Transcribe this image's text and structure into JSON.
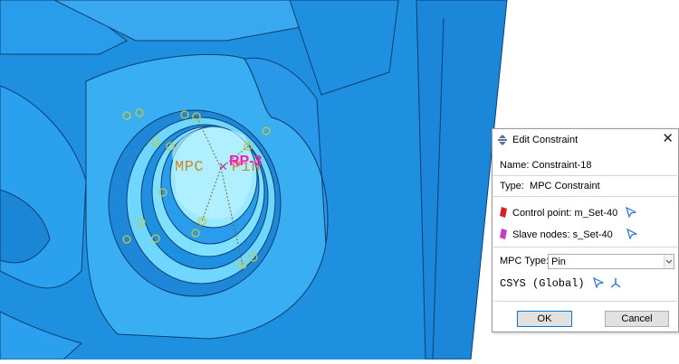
{
  "viewport": {
    "mpc_label": "MPC",
    "pin_label": "Pin",
    "rp_label": "RP-3",
    "rp_mark": "✕"
  },
  "colors": {
    "part_blue": "#1e90e6",
    "part_light": "#55c8f5",
    "label_orange": "#c98a2e",
    "rp_magenta": "#ff1ab3",
    "node_yellow": "#c8c83a"
  },
  "dialog": {
    "title": "Edit Constraint",
    "close_glyph": "✕",
    "name_label": "Name:",
    "name_value": "Constraint-18",
    "type_label": "Type:",
    "type_value": "MPC Constraint",
    "control_point_label": "Control point:",
    "control_point_value": "m_Set-40",
    "slave_nodes_label": "Slave nodes:",
    "slave_nodes_value": "s_Set-40",
    "mpc_type_label": "MPC Type:",
    "mpc_type_value": "Pin",
    "csys_label": "CSYS (Global)",
    "ok_label": "OK",
    "cancel_label": "Cancel",
    "icons": {
      "title": "edit-constraint-icon",
      "control_flag": "red-flag-icon",
      "slave_flag": "magenta-flag-icon",
      "picker": "arrow-picker-icon",
      "csys": "csys-axes-icon",
      "dropdown": "chevron-down-icon"
    }
  }
}
